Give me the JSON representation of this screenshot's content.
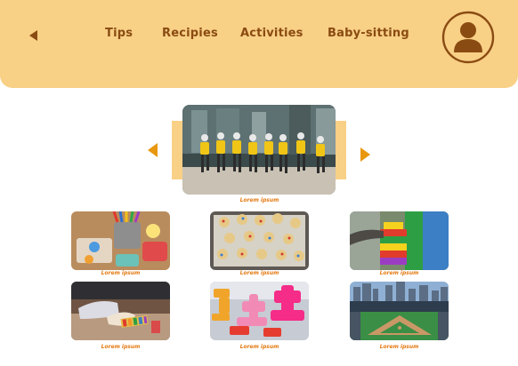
{
  "header": {
    "nav": [
      "Tips",
      "Recipies",
      "Activities",
      "Baby-sitting"
    ],
    "back_icon": "triangle-left-icon",
    "avatar_icon": "user-avatar-icon"
  },
  "carousel": {
    "prev_icon": "triangle-left-icon",
    "next_icon": "triangle-right-icon",
    "featured_caption": "Lorem ipsum"
  },
  "gallery": {
    "captions": [
      "Lorem ipsum",
      "Lorem ipsum",
      "Lorem ipsum",
      "Lorem ipsum",
      "Lorem ipsum",
      "Lorem ipsum"
    ]
  },
  "colors": {
    "header_bg": "#f8d086",
    "nav_text": "#8a4b12",
    "accent": "#e8970f",
    "caption": "#e37a12"
  }
}
